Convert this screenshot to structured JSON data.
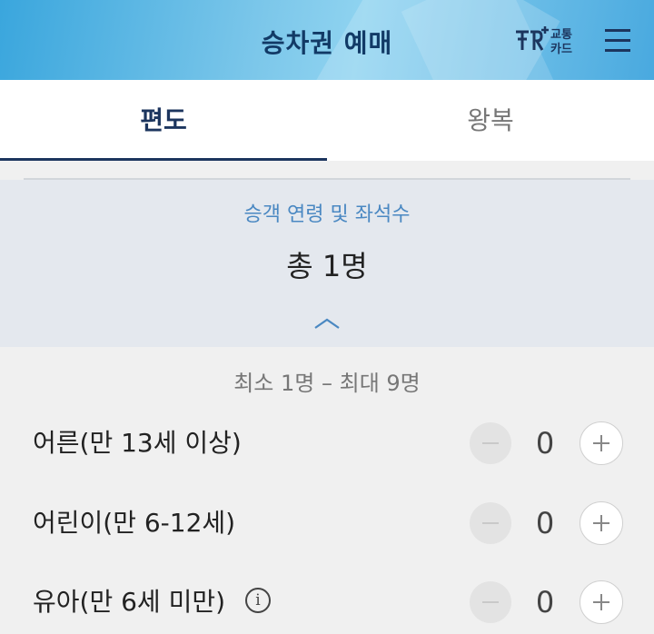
{
  "header": {
    "title": "승차권 예매",
    "card_logo_line1": "교통",
    "card_logo_line2": "카드",
    "card_logo_icon": "rail-plus-card-icon",
    "menu_icon": "hamburger-menu-icon"
  },
  "tabs": [
    {
      "label": "편도",
      "active": true
    },
    {
      "label": "왕복",
      "active": false
    }
  ],
  "passenger_section": {
    "label": "승객 연령 및 좌석수",
    "total": "총 1명",
    "collapse_icon": "chevron-up-icon",
    "range": "최소 1명 – 최대 9명"
  },
  "passenger_rows": [
    {
      "label": "어른(만 13세 이상)",
      "count": "0"
    },
    {
      "label": "어린이(만 6-12세)",
      "count": "0"
    },
    {
      "label": "유아(만 6세 미만)",
      "count": "0",
      "info_icon": "i"
    }
  ],
  "colors": {
    "navy": "#1c355e",
    "accent_blue": "#4a88c2",
    "header_bg": "#e4e8ee"
  }
}
